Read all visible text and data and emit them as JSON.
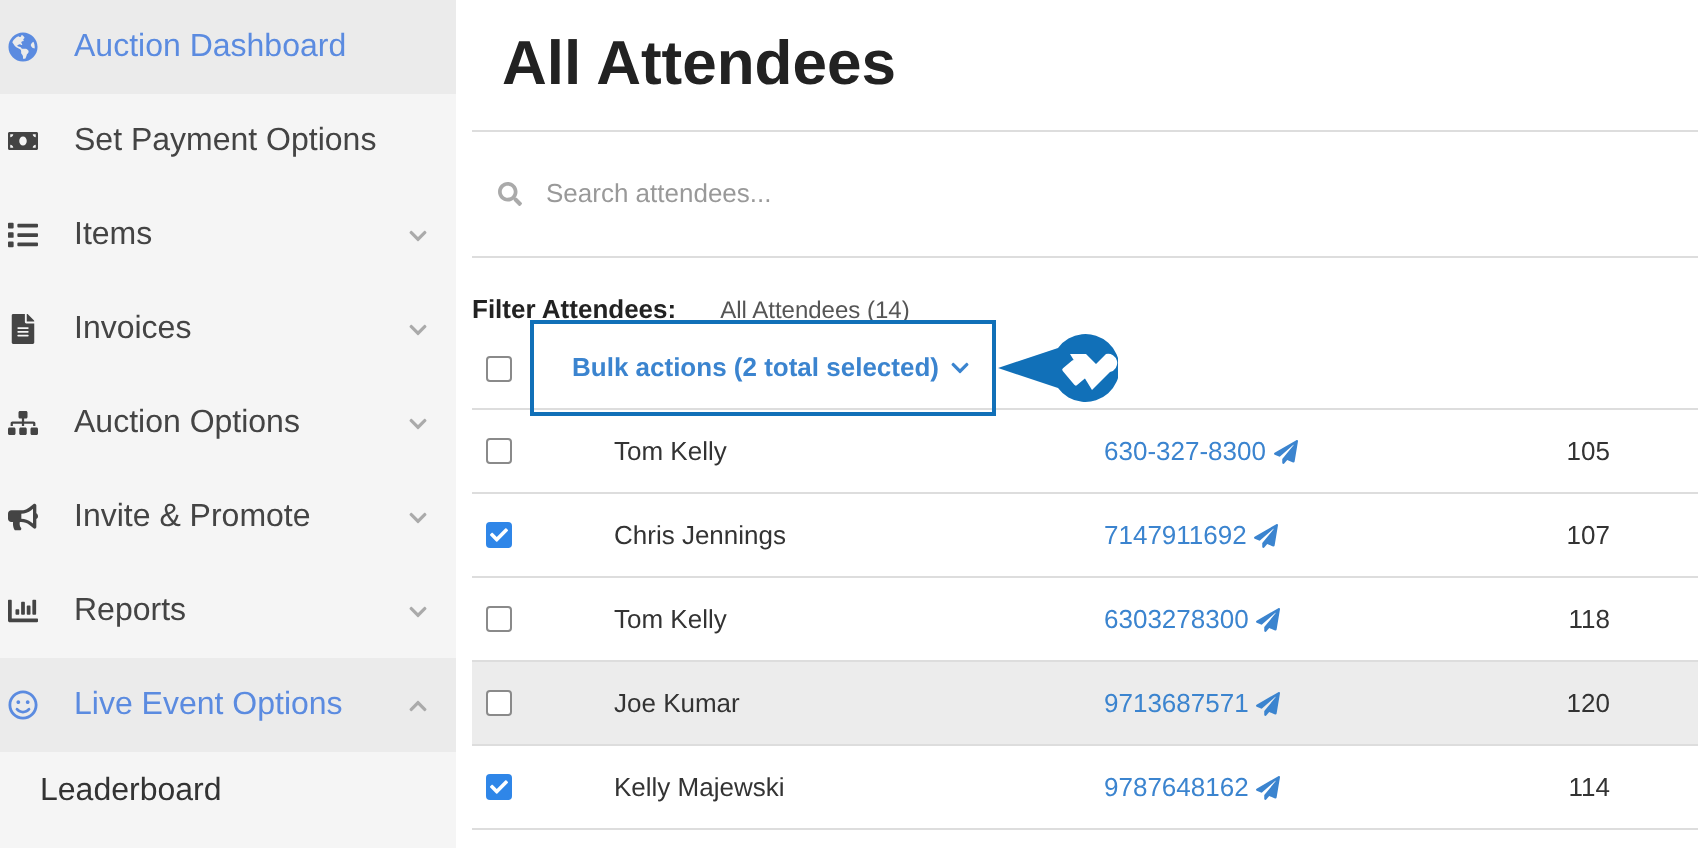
{
  "sidebar": {
    "items": [
      {
        "label": "Auction Dashboard",
        "selected": true
      },
      {
        "label": "Set Payment Options",
        "selected": false
      },
      {
        "label": "Items",
        "selected": false,
        "expanded": false
      },
      {
        "label": "Invoices",
        "selected": false,
        "expanded": false
      },
      {
        "label": "Auction Options",
        "selected": false,
        "expanded": false
      },
      {
        "label": "Invite & Promote",
        "selected": false,
        "expanded": false
      },
      {
        "label": "Reports",
        "selected": false,
        "expanded": false
      },
      {
        "label": "Live Event Options",
        "selected": true,
        "expanded": true,
        "children": [
          {
            "label": "Leaderboard"
          }
        ]
      }
    ]
  },
  "page": {
    "title": "All Attendees"
  },
  "search": {
    "placeholder": "Search attendees..."
  },
  "filter": {
    "label": "Filter Attendees:",
    "value": "All Attendees (14)"
  },
  "bulk_actions": {
    "label": "Bulk actions (2 total selected)",
    "checked": false
  },
  "rows": [
    {
      "name": "Tom Kelly",
      "phone": "630-327-8300",
      "number": "105",
      "checked": false,
      "highlighted": false
    },
    {
      "name": "Chris Jennings",
      "phone": "7147911692",
      "number": "107",
      "checked": true,
      "highlighted": false
    },
    {
      "name": "Tom Kelly",
      "phone": "6303278300",
      "number": "118",
      "checked": false,
      "highlighted": false
    },
    {
      "name": "Joe Kumar",
      "phone": "9713687571",
      "number": "120",
      "checked": false,
      "highlighted": true
    },
    {
      "name": "Kelly Majewski",
      "phone": "9787648162",
      "number": "114",
      "checked": true,
      "highlighted": false
    }
  ]
}
